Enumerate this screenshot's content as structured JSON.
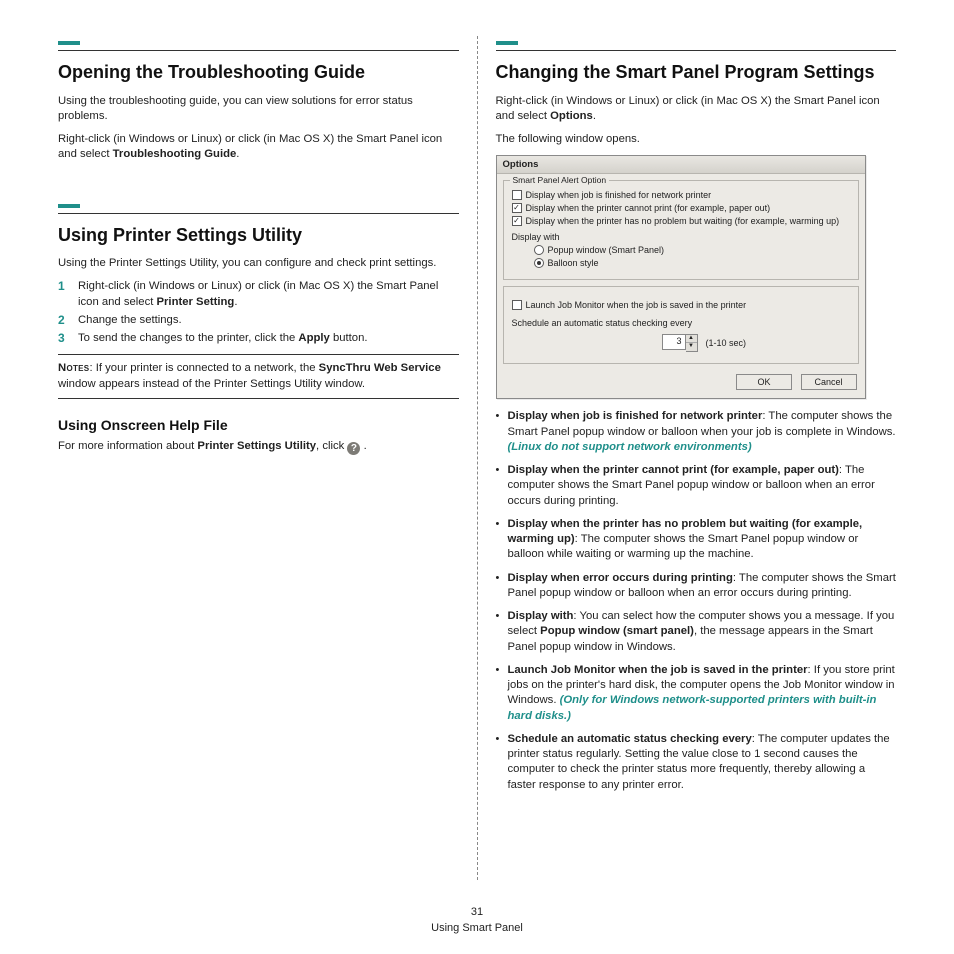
{
  "footer": {
    "page_num": "31",
    "label": "Using Smart Panel"
  },
  "left": {
    "s1": {
      "title": "Opening the Troubleshooting Guide",
      "p1": "Using the troubleshooting guide, you can view solutions for error status problems.",
      "p2a": "Right-click (in Windows or Linux) or click (in Mac OS X) the Smart Panel icon and select ",
      "p2b": "Troubleshooting Guide",
      "p2c": "."
    },
    "s2": {
      "title": "Using Printer Settings Utility",
      "intro": "Using the Printer Settings Utility, you can configure and check print settings.",
      "steps": {
        "n1": "1",
        "t1a": "Right-click (in Windows or Linux) or click (in Mac OS X) the Smart Panel icon and select ",
        "t1b": "Printer Setting",
        "t1c": ".",
        "n2": "2",
        "t2": "Change the settings.",
        "n3": "3",
        "t3a": "To send the changes to the printer, click the ",
        "t3b": "Apply",
        "t3c": " button."
      },
      "notes": {
        "label": "Notes",
        "a": ": If your printer is connected to a network, the ",
        "b": "SyncThru Web Service",
        "c": " window appears instead of the Printer Settings Utility window."
      }
    },
    "s3": {
      "title": "Using Onscreen Help File",
      "a": "For more information about ",
      "b": "Printer Settings Utility",
      "c": ", click ",
      "d": "."
    }
  },
  "right": {
    "title": "Changing the Smart Panel Program Settings",
    "p1a": "Right-click (in Windows or Linux) or click (in Mac OS X) the Smart Panel icon and select ",
    "p1b": "Options",
    "p1c": ".",
    "p2": "The following window opens.",
    "dialog": {
      "title": "Options",
      "legend": "Smart Panel Alert Option",
      "cb1": "Display when job is finished for network printer",
      "cb2": "Display when the printer cannot print (for example, paper out)",
      "cb3": "Display when the printer has no problem but waiting (for example, warming up)",
      "disp_label": "Display with",
      "r1": "Popup window (Smart Panel)",
      "r2": "Balloon style",
      "cb4": "Launch Job Monitor when the job is saved in the printer",
      "sched": "Schedule an automatic status checking every",
      "spin_val": "3",
      "spin_hint": "(1-10 sec)",
      "ok": "OK",
      "cancel": "Cancel"
    },
    "bullets": {
      "b1a": "Display when job is finished for network printer",
      "b1b": ": The computer shows the Smart Panel popup window or balloon when your job is complete in Windows. ",
      "b1c": "(Linux do not support network environments)",
      "b2a": "Display when the printer cannot print (for example, paper out)",
      "b2b": ": The computer shows the Smart Panel popup window or balloon when an error occurs during printing.",
      "b3a": "Display when the printer has no problem but waiting (for example, warming up)",
      "b3b": ": The computer shows the Smart Panel popup window or balloon while waiting or warming up the machine.",
      "b4a": "Display when error occurs during printing",
      "b4b": ": The computer shows the Smart Panel popup window or balloon when an error occurs during printing.",
      "b5a": "Display with",
      "b5b": ": You can select how the computer shows you a message. If you select ",
      "b5c": "Popup window (smart panel)",
      "b5d": ", the message appears in the Smart Panel popup window in Windows.",
      "b6a": "Launch Job Monitor when the job is saved in the printer",
      "b6b": ": If you store print jobs on the printer's hard disk, the computer opens the Job Monitor window in Windows. ",
      "b6c": "(Only for Windows network-supported printers with built-in hard disks.)",
      "b7a": "Schedule an automatic status checking every",
      "b7b": ": The computer updates the printer status regularly. Setting the value close to 1 second causes the computer to check the printer status more frequently, thereby allowing a faster response to any printer error."
    }
  }
}
